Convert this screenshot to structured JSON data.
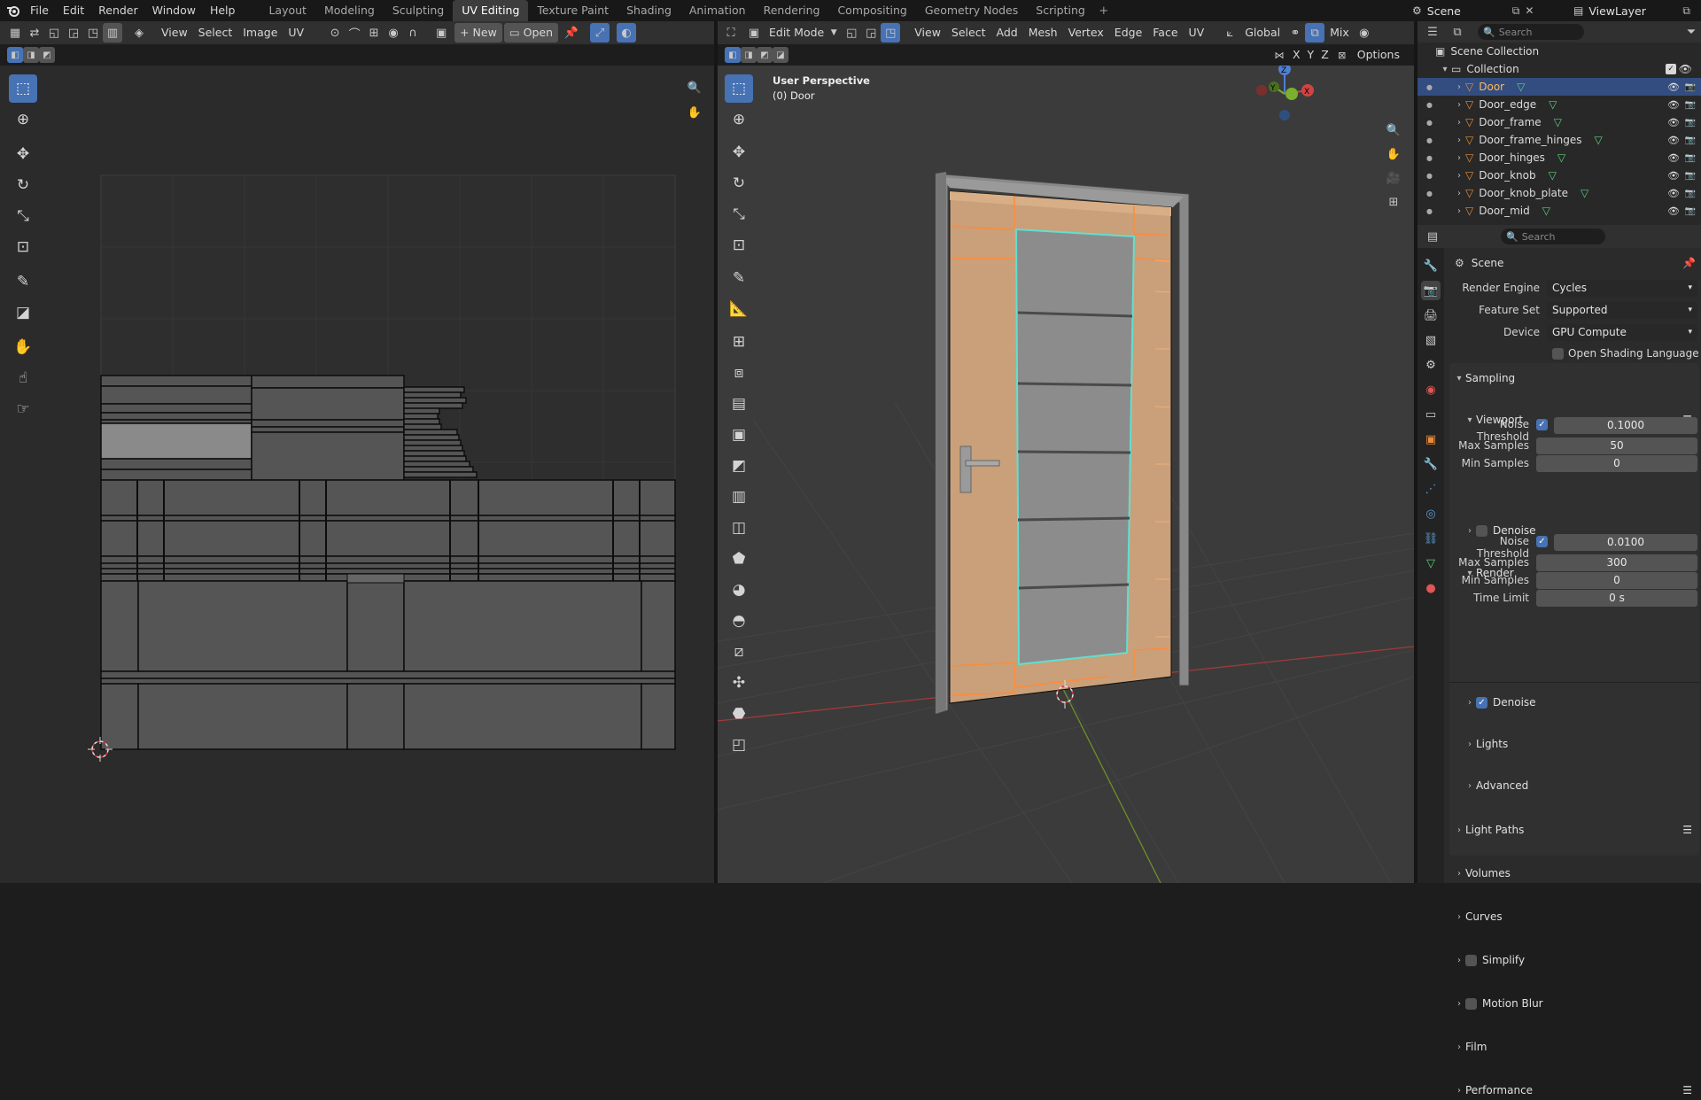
{
  "top_menu": [
    "File",
    "Edit",
    "Render",
    "Window",
    "Help"
  ],
  "workspace_tabs": [
    "Layout",
    "Modeling",
    "Sculpting",
    "UV Editing",
    "Texture Paint",
    "Shading",
    "Animation",
    "Rendering",
    "Compositing",
    "Geometry Nodes",
    "Scripting"
  ],
  "active_workspace": "UV Editing",
  "scene_name": "Scene",
  "view_layer": "ViewLayer",
  "uv_editor": {
    "menus": [
      "View",
      "Select",
      "Image",
      "UV"
    ],
    "new_label": "New",
    "open_label": "Open"
  },
  "viewport": {
    "mode": "Edit Mode",
    "menus": [
      "View",
      "Select",
      "Add",
      "Mesh",
      "Vertex",
      "Edge",
      "Face",
      "UV"
    ],
    "orientation": "Global",
    "shading_mix": "Mix",
    "axis_x": "X",
    "axis_y": "Y",
    "axis_z": "Z",
    "options": "Options",
    "overlay_title": "User Perspective",
    "overlay_sub": "(0) Door",
    "gizmo": {
      "x": "X",
      "y": "Y",
      "z": "Z"
    }
  },
  "outliner": {
    "search_placeholder": "Search",
    "scene_collection": "Scene Collection",
    "collection": "Collection",
    "items": [
      "Door",
      "Door_edge",
      "Door_frame",
      "Door_frame_hinges",
      "Door_hinges",
      "Door_knob",
      "Door_knob_plate",
      "Door_mid"
    ]
  },
  "properties": {
    "search_placeholder": "Search",
    "context": "Scene",
    "render_engine_label": "Render Engine",
    "render_engine": "Cycles",
    "feature_set_label": "Feature Set",
    "feature_set": "Supported",
    "device_label": "Device",
    "device": "GPU Compute",
    "osl_label": "Open Shading Language",
    "sampling": "Sampling",
    "viewport": "Viewport",
    "noise_threshold_label": "Noise Threshold",
    "viewport_noise": "0.1000",
    "max_samples_label": "Max Samples",
    "viewport_max": "50",
    "min_samples_label": "Min Samples",
    "viewport_min": "0",
    "denoise": "Denoise",
    "render": "Render",
    "render_noise": "0.0100",
    "render_max": "300",
    "render_min": "0",
    "time_limit_label": "Time Limit",
    "time_limit": "0 s",
    "lights": "Lights",
    "advanced": "Advanced",
    "light_paths": "Light Paths",
    "volumes": "Volumes",
    "curves": "Curves",
    "simplify": "Simplify",
    "motion_blur": "Motion Blur",
    "film": "Film",
    "performance": "Performance"
  },
  "colors": {
    "accent": "#4772b3",
    "door_wood": "#c9a07a",
    "selected_edge": "#ff8a3a",
    "active_face_edge": "#5fe0d0"
  }
}
